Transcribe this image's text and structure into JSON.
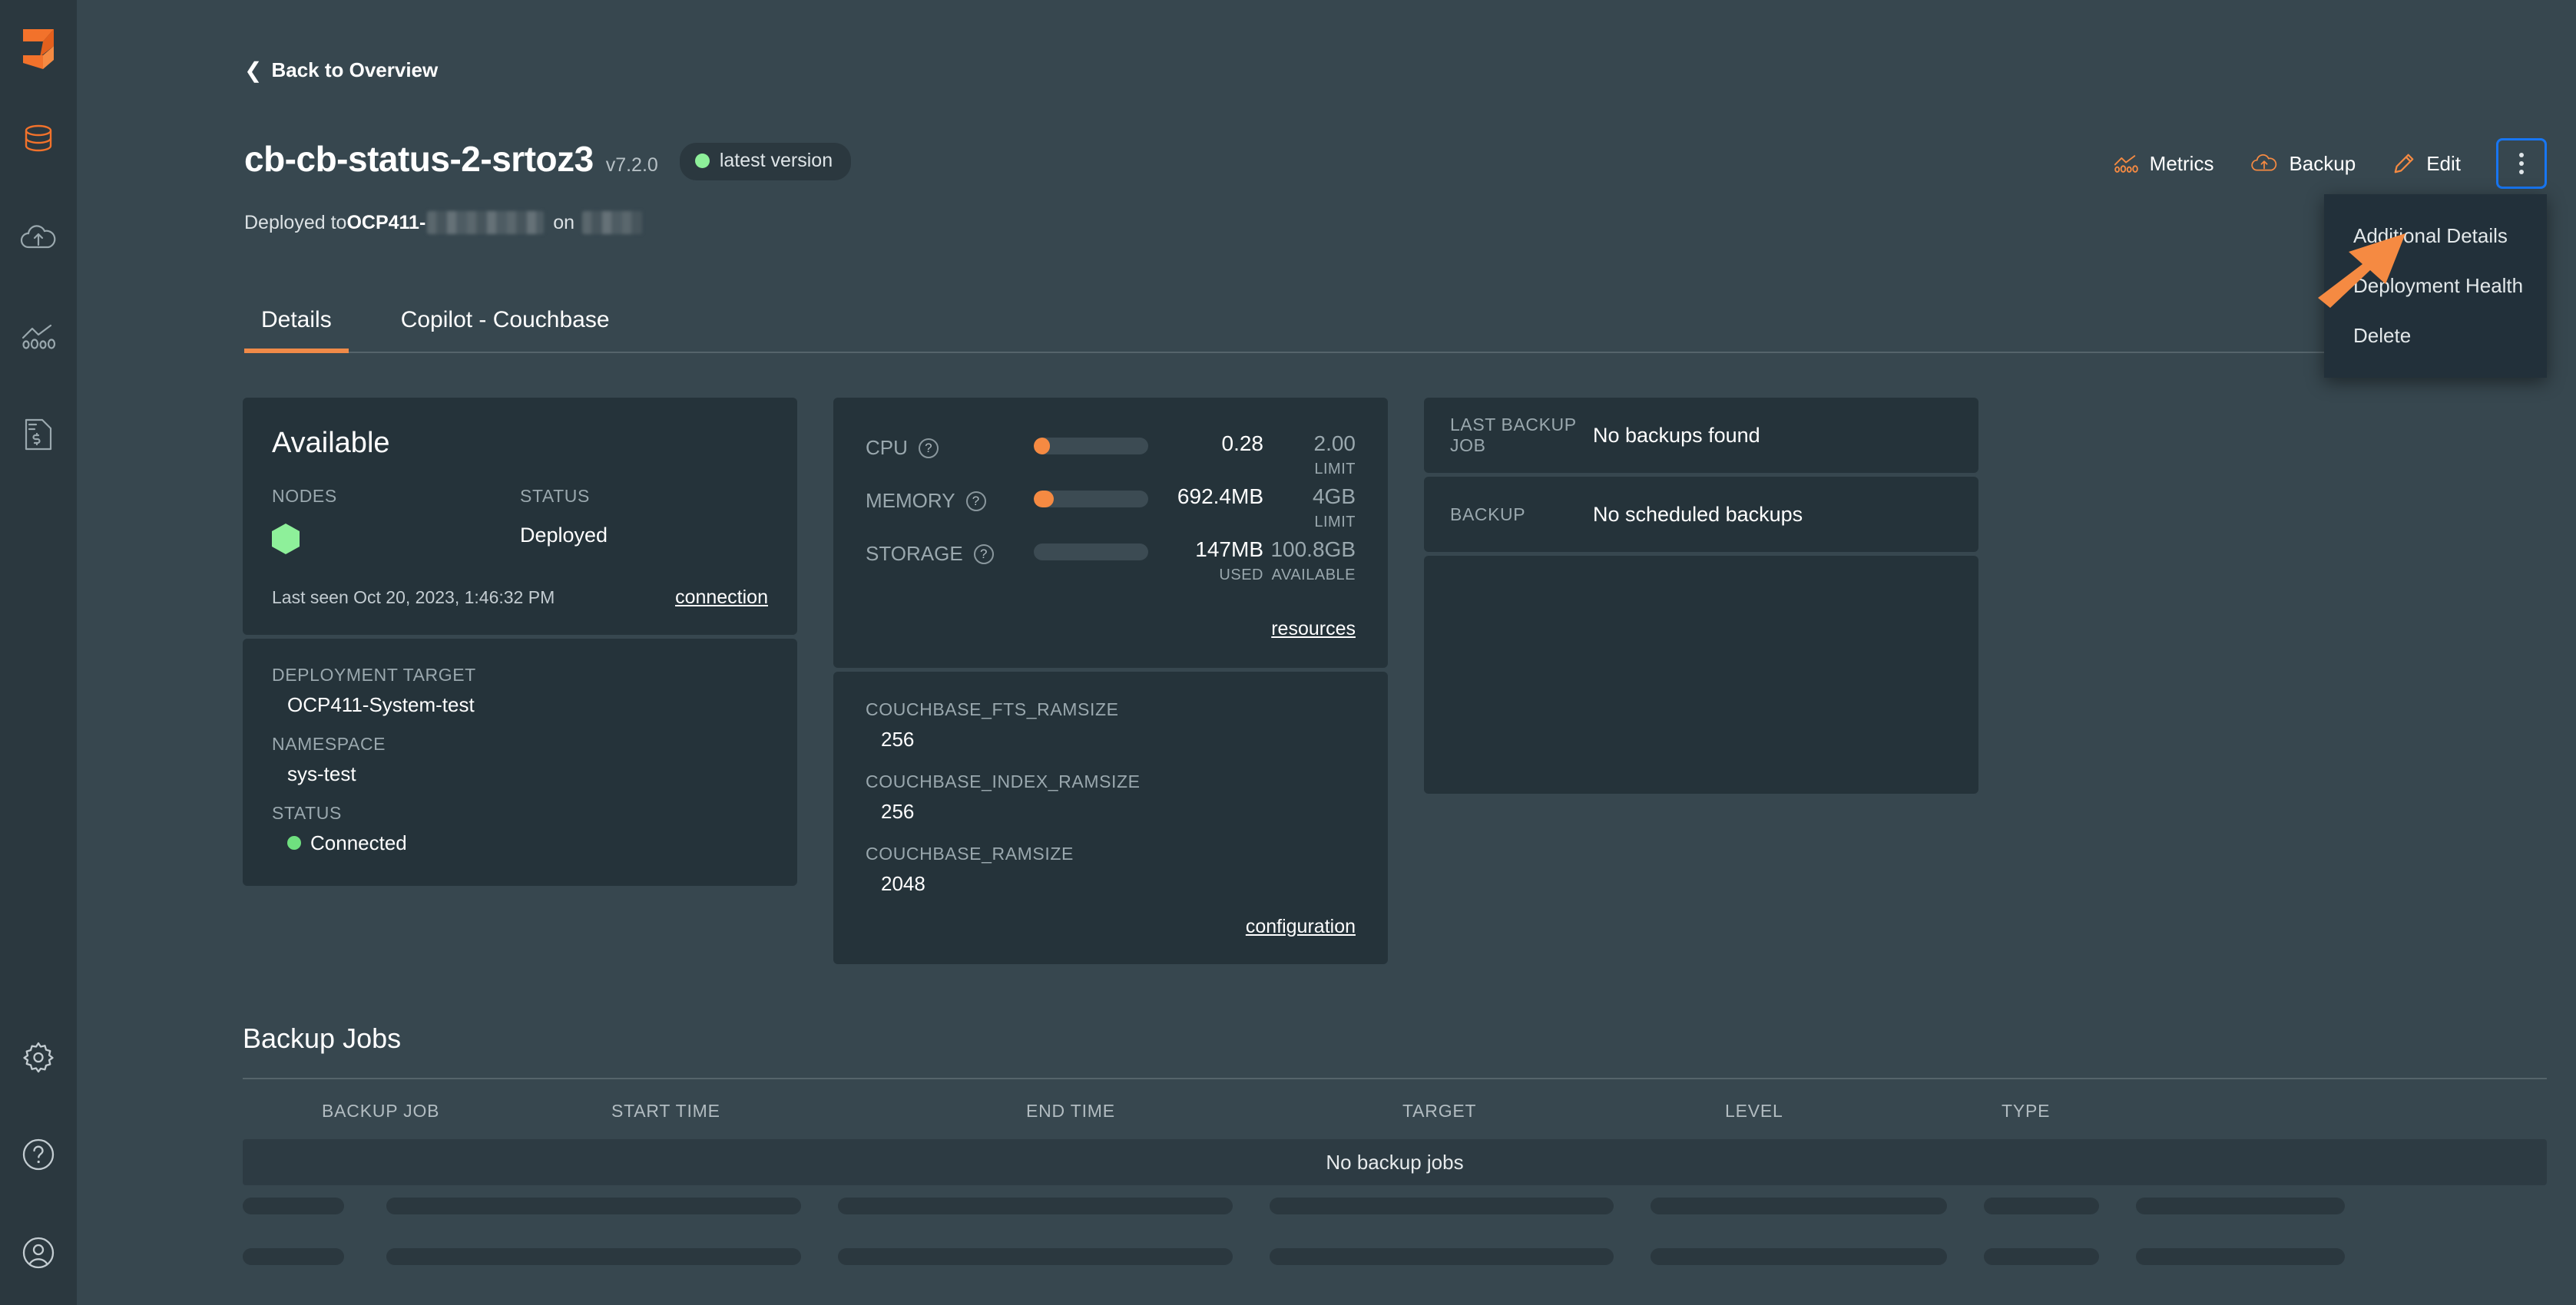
{
  "sidebar": {
    "logo_name": "brand-logo",
    "items": [
      {
        "name": "database-icon",
        "label": "Databases"
      },
      {
        "name": "cloud-upload-icon",
        "label": "Backups"
      },
      {
        "name": "metrics-chart-icon",
        "label": "Metrics"
      },
      {
        "name": "billing-document-icon",
        "label": "Billing"
      }
    ],
    "bottom_items": [
      {
        "name": "gear-icon",
        "label": "Settings"
      },
      {
        "name": "help-circle-icon",
        "label": "Help"
      },
      {
        "name": "account-circle-icon",
        "label": "Account"
      }
    ]
  },
  "header": {
    "back_label": "Back to Overview",
    "title": "cb-cb-status-2-srtoz3",
    "version": "v7.2.0",
    "badge_label": "latest version",
    "badge_dot_color": "#8ef09a",
    "deployed_prefix": "Deployed to ",
    "deployed_target": "OCP411-",
    "deployed_on": "on"
  },
  "toolbar": {
    "metrics_label": "Metrics",
    "backup_label": "Backup",
    "edit_label": "Edit",
    "kebab_name": "more-actions",
    "focus_ring_color": "#1876f2"
  },
  "dropdown": {
    "items": [
      {
        "label": "Additional Details"
      },
      {
        "label": "Deployment Health"
      },
      {
        "label": "Delete"
      }
    ]
  },
  "tabs": [
    {
      "label": "Details",
      "active": true
    },
    {
      "label": "Copilot - Couchbase",
      "active": false
    }
  ],
  "available_card": {
    "title": "Available",
    "nodes_label": "NODES",
    "status_label": "STATUS",
    "status_value": "Deployed",
    "node_color": "#8ef09a",
    "last_seen": "Last seen Oct 20, 2023, 1:46:32 PM",
    "connection_link": "connection"
  },
  "target_card": {
    "deployment_target_label": "DEPLOYMENT TARGET",
    "deployment_target_value": "OCP411-System-test",
    "namespace_label": "NAMESPACE",
    "namespace_value": "sys-test",
    "status_label": "STATUS",
    "status_value": "Connected",
    "status_dot_color": "#6fe07f"
  },
  "resources_card": {
    "rows": [
      {
        "name": "CPU",
        "fill_pct": 14,
        "value": "0.28",
        "limit": "2.00",
        "value_sub": "",
        "limit_sub": "LIMIT"
      },
      {
        "name": "MEMORY",
        "fill_pct": 17,
        "value": "692.4MB",
        "limit": "4GB",
        "value_sub": "",
        "limit_sub": "LIMIT"
      },
      {
        "name": "STORAGE",
        "fill_pct": 0,
        "value": "147MB",
        "limit": "100.8GB",
        "value_sub": "USED",
        "limit_sub": "AVAILABLE"
      }
    ],
    "link": "resources",
    "bar_color": "#f58a42"
  },
  "configuration_card": {
    "entries": [
      {
        "key": "COUCHBASE_FTS_RAMSIZE",
        "value": "256"
      },
      {
        "key": "COUCHBASE_INDEX_RAMSIZE",
        "value": "256"
      },
      {
        "key": "COUCHBASE_RAMSIZE",
        "value": "2048"
      }
    ],
    "link": "configuration"
  },
  "backup_card": {
    "rows": [
      {
        "label": "LAST BACKUP JOB",
        "value": "No backups found"
      },
      {
        "label": "BACKUP",
        "value": "No scheduled backups"
      }
    ]
  },
  "backup_jobs": {
    "title": "Backup Jobs",
    "columns": [
      "BACKUP JOB",
      "START TIME",
      "END TIME",
      "TARGET",
      "LEVEL",
      "TYPE"
    ],
    "empty_message": "No backup jobs"
  },
  "theme": {
    "page_bg": "#37474f",
    "card_bg": "#25333a",
    "sidebar_bg": "#2b383f",
    "accent": "#f58a42"
  }
}
